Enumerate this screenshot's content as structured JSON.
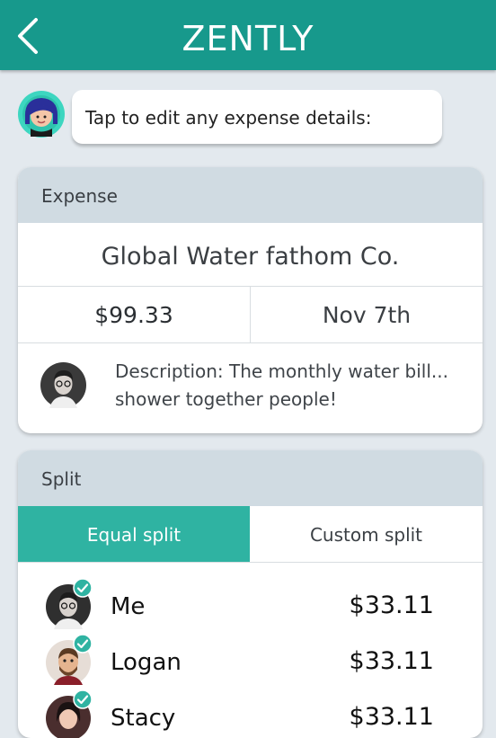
{
  "header": {
    "title": "ZENTLY",
    "back_icon": "chevron-left-icon"
  },
  "assistant": {
    "message": "Tap to edit any expense details:"
  },
  "expense": {
    "section_label": "Expense",
    "payee": "Global Water fathom Co.",
    "amount": "$99.33",
    "date": "Nov 7th",
    "description": "Description: The monthly water bill... shower together people!"
  },
  "split": {
    "section_label": "Split",
    "tabs": [
      {
        "label": "Equal split",
        "selected": true
      },
      {
        "label": "Custom split",
        "selected": false
      }
    ],
    "people": [
      {
        "name": "Me",
        "amount": "$33.11",
        "checked": true
      },
      {
        "name": "Logan",
        "amount": "$33.11",
        "checked": true
      },
      {
        "name": "Stacy",
        "amount": "$33.11",
        "checked": true
      }
    ]
  },
  "colors": {
    "brand": "#17998c",
    "accent": "#2fb3a2",
    "section_header": "#d0dbe2",
    "background": "#e3e9ee"
  }
}
